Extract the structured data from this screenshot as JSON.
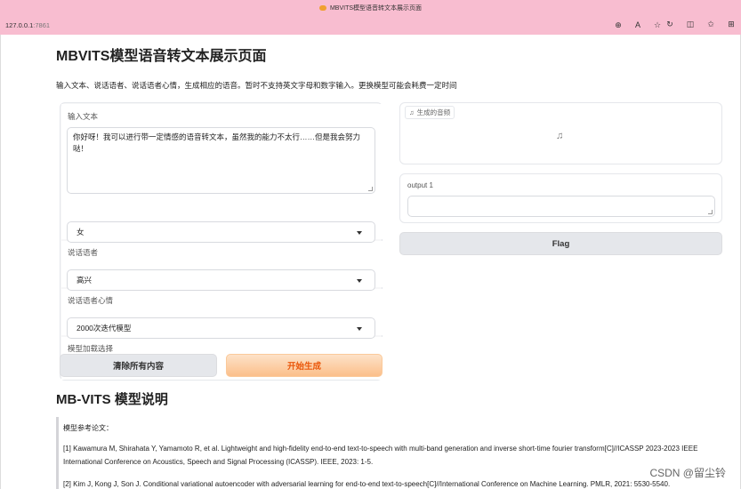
{
  "browser": {
    "tab_title": "MBVITS模型语音转文本展示页面",
    "url_host": "127.0.0.1",
    "url_port": ":7861",
    "toolbar_icons": [
      "zoom-icon",
      "read-aloud-icon",
      "favorite-star-icon",
      "refresh-icon",
      "split-screen-icon",
      "favorites-icon",
      "collections-icon"
    ]
  },
  "page": {
    "title": "MBVITS模型语音转文本展示页面",
    "description": "输入文本、说话语者、说话语者心情，生成相应的语音。暂时不支持英文字母和数字输入。更换模型可能会耗费一定时间"
  },
  "form": {
    "text_label": "输入文本",
    "text_value": "你好呀！我可以进行带一定情感的语音转文本，虽然我的能力不太行……但是我会努力哒！",
    "speaker_label": "说话语者",
    "speaker_value": "女",
    "mood_label": "说话语者心情",
    "mood_value": "高兴",
    "model_label": "模型加载选择",
    "model_value": "2000次迭代模型",
    "clear_button": "清除所有内容",
    "generate_button": "开始生成"
  },
  "output": {
    "audio_label": "生成的音频",
    "text_label": "output 1",
    "flag_button": "Flag"
  },
  "docs": {
    "heading": "MB-VITS 模型说明",
    "ref_title": "模型参考论文：",
    "ref1_line1": "[1] Kawamura M, Shirahata Y, Yamamoto R, et al. Lightweight and high-fidelity end-to-end text-to-speech with multi-band generation and inverse short-time fourier transform[C]//ICASSP 2023-2023 IEEE",
    "ref1_line2": "International Conference on Acoustics, Speech and Signal Processing (ICASSP). IEEE, 2023: 1-5.",
    "ref2": "[2] Kim J, Kong J, Son J. Conditional variational autoencoder with adversarial learning for end-to-end text-to-speech[C]//International Conference on Machine Learning. PMLR, 2021: 5530-5540."
  },
  "watermark": "CSDN @留尘铃"
}
